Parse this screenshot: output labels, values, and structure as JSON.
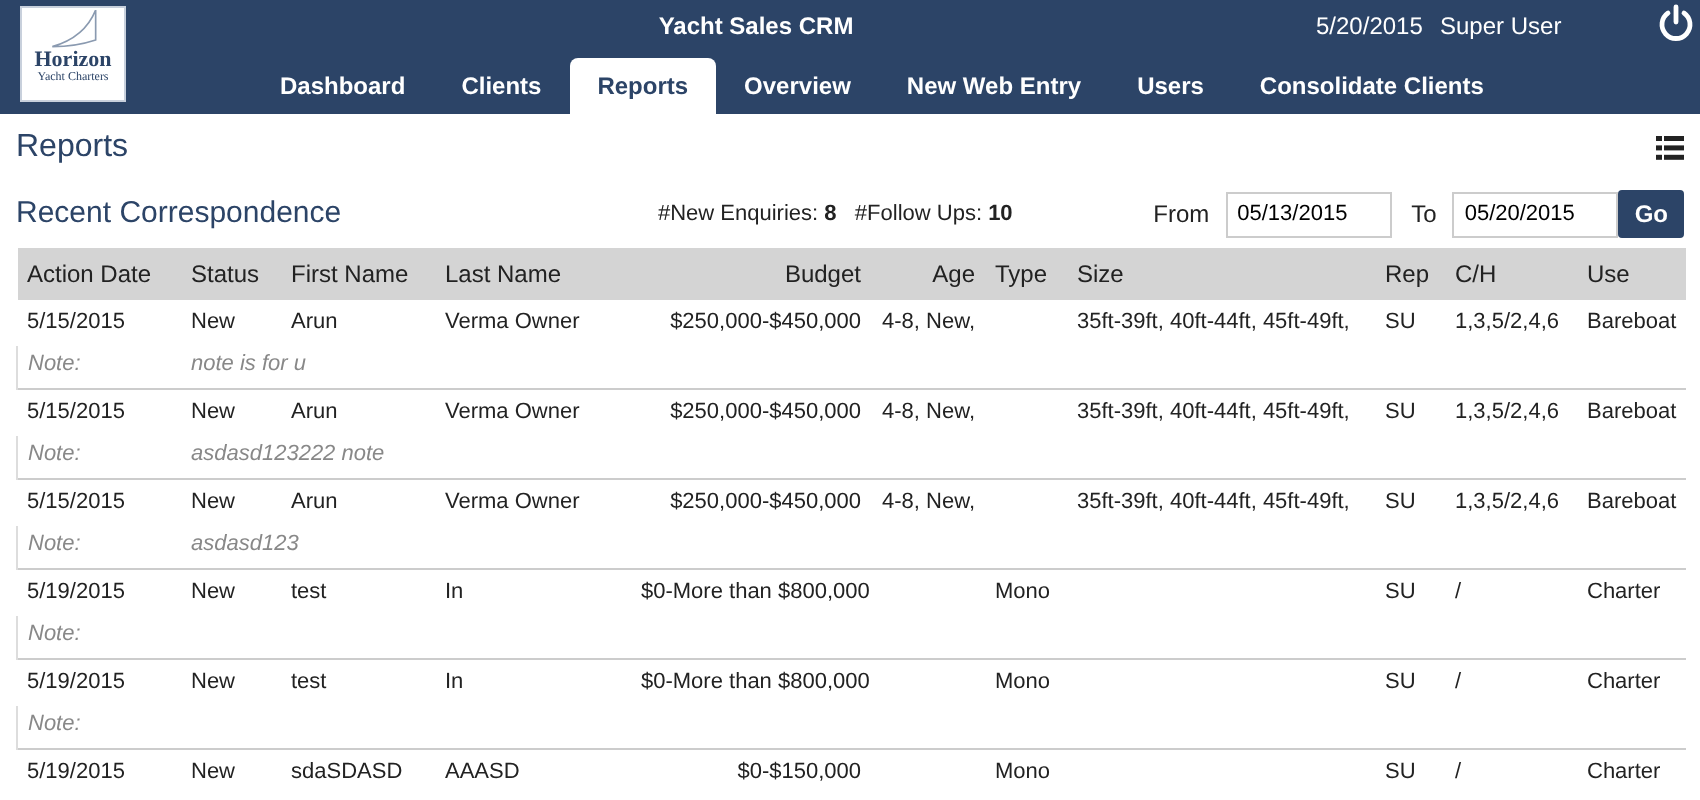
{
  "header": {
    "logo": {
      "name": "Horizon",
      "tagline": "Yacht Charters"
    },
    "title": "Yacht Sales CRM",
    "date": "5/20/2015",
    "user": "Super User"
  },
  "tabs": [
    {
      "label": "Dashboard",
      "selected": false
    },
    {
      "label": "Clients",
      "selected": false
    },
    {
      "label": "Reports",
      "selected": true
    },
    {
      "label": "Overview",
      "selected": false
    },
    {
      "label": "New Web Entry",
      "selected": false
    },
    {
      "label": "Users",
      "selected": false
    },
    {
      "label": "Consolidate Clients",
      "selected": false
    }
  ],
  "page_title": "Reports",
  "section": {
    "title": "Recent Correspondence",
    "new_enquiries_label": "#New Enquiries:",
    "new_enquiries": "8",
    "follow_ups_label": "#Follow Ups:",
    "follow_ups": "10",
    "from_label": "From",
    "from": "05/13/2015",
    "to_label": "To",
    "to": "05/20/2015",
    "go": "Go"
  },
  "table": {
    "columns": [
      "Action Date",
      "Status",
      "First Name",
      "Last Name",
      "Budget",
      "Age",
      "Type",
      "Size",
      "Rep",
      "C/H",
      "Use"
    ],
    "rows": [
      {
        "cells": [
          "5/15/2015",
          "New",
          "Arun",
          "Verma Owner",
          "$250,000-$450,000",
          "4-8, New,",
          "",
          "35ft-39ft, 40ft-44ft, 45ft-49ft,",
          "SU",
          "1,3,5/2,4,6",
          "Bareboat"
        ],
        "note_label": "Note:",
        "note": "note is for u"
      },
      {
        "cells": [
          "5/15/2015",
          "New",
          "Arun",
          "Verma Owner",
          "$250,000-$450,000",
          "4-8, New,",
          "",
          "35ft-39ft, 40ft-44ft, 45ft-49ft,",
          "SU",
          "1,3,5/2,4,6",
          "Bareboat"
        ],
        "note_label": "Note:",
        "note": "asdasd123222 note"
      },
      {
        "cells": [
          "5/15/2015",
          "New",
          "Arun",
          "Verma Owner",
          "$250,000-$450,000",
          "4-8, New,",
          "",
          "35ft-39ft, 40ft-44ft, 45ft-49ft,",
          "SU",
          "1,3,5/2,4,6",
          "Bareboat"
        ],
        "note_label": "Note:",
        "note": "asdasd123"
      },
      {
        "cells": [
          "5/19/2015",
          "New",
          "test",
          "In",
          "$0-More than $800,000",
          "",
          "Mono",
          "",
          "SU",
          "/",
          "Charter"
        ],
        "note_label": "Note:"
      },
      {
        "cells": [
          "5/19/2015",
          "New",
          "test",
          "In",
          "$0-More than $800,000",
          "",
          "Mono",
          "",
          "SU",
          "/",
          "Charter"
        ],
        "note_label": "Note:"
      },
      {
        "cells": [
          "5/19/2015",
          "New",
          "sdaSDASD",
          "AAASD",
          "$0-$150,000",
          "",
          "Mono",
          "",
          "SU",
          "/",
          "Charter"
        ]
      }
    ]
  }
}
